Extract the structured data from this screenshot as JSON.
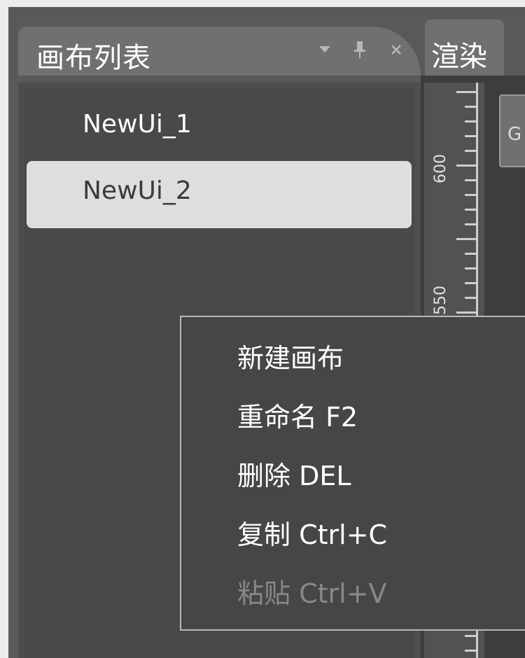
{
  "panel": {
    "title": "画布列表",
    "buttons": {
      "dropdown_icon": "chevron-down-icon",
      "pin_icon": "pin-icon",
      "close_icon": "close-icon"
    }
  },
  "render_tab": {
    "label": "渲染"
  },
  "canvas_list": {
    "items": [
      {
        "label": "NewUi_1",
        "selected": false
      },
      {
        "label": "NewUi_2",
        "selected": true
      }
    ]
  },
  "ruler": {
    "labels": [
      "600",
      "550"
    ]
  },
  "canvas_preview": {
    "label": "G"
  },
  "context_menu": {
    "items": [
      {
        "label": "新建画布",
        "enabled": true
      },
      {
        "label": "重命名 F2",
        "enabled": true
      },
      {
        "label": "删除 DEL",
        "enabled": true
      },
      {
        "label": "复制  Ctrl+C",
        "enabled": true
      },
      {
        "label": "粘贴  Ctrl+V",
        "enabled": false
      }
    ]
  },
  "colors": {
    "panel_bg": "#494949",
    "selected_item_bg": "#dedede",
    "menu_bg": "#464646",
    "disabled_text": "#888888"
  }
}
